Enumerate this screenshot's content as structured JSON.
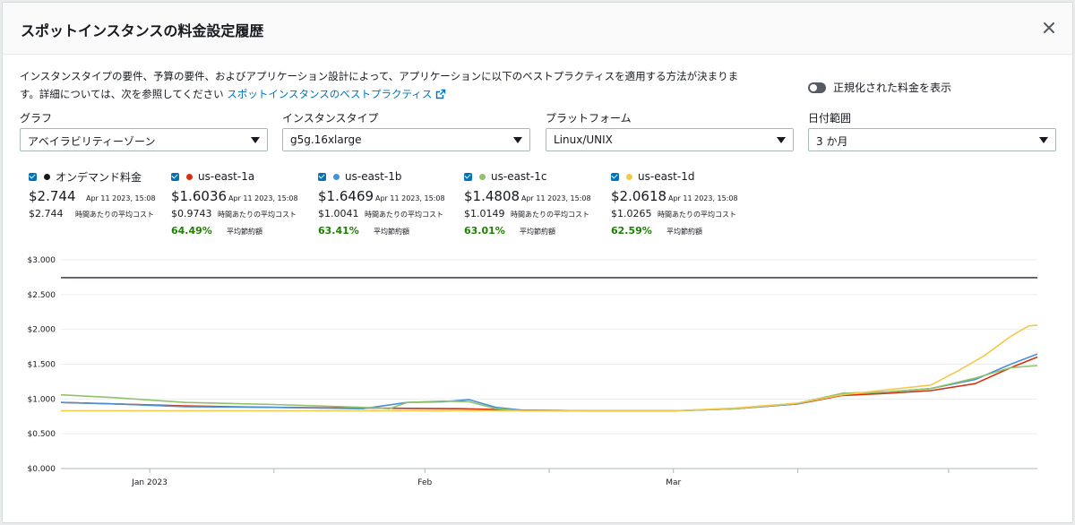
{
  "modal": {
    "title": "スポットインスタンスの料金設定履歴",
    "close_icon": "close-icon"
  },
  "description": {
    "text": "インスタンスタイプの要件、予算の要件、およびアプリケーション設計によって、アプリケーションに以下のベストプラクティスを適用する方法が決まります。詳細については、次を参照してください",
    "link_label": "スポットインスタンスのベストプラクティス",
    "link_icon": "external-link-icon"
  },
  "toggle": {
    "label": "正規化された料金を表示",
    "on": false
  },
  "filters": [
    {
      "label": "グラフ",
      "value": "アベイラビリティーゾーン"
    },
    {
      "label": "インスタンスタイプ",
      "value": "g5g.16xlarge"
    },
    {
      "label": "プラットフォーム",
      "value": "Linux/UNIX"
    },
    {
      "label": "日付範囲",
      "value": "3 か月"
    }
  ],
  "legend": [
    {
      "name": "オンデマンド料金",
      "color": "#16191f",
      "price": "$2.744",
      "timestamp": "Apr 11 2023, 15:08",
      "avg": "$2.744",
      "avg_label": "時間あたりの平均コスト",
      "savings": "",
      "savings_label": ""
    },
    {
      "name": "us-east-1a",
      "color": "#d13212",
      "price": "$1.6036",
      "timestamp": "Apr 11 2023, 15:08",
      "avg": "$0.9743",
      "avg_label": "時間あたりの平均コスト",
      "savings": "64.49%",
      "savings_label": "平均節約額"
    },
    {
      "name": "us-east-1b",
      "color": "#4a90d9",
      "price": "$1.6469",
      "timestamp": "Apr 11 2023, 15:08",
      "avg": "$1.0041",
      "avg_label": "時間あたりの平均コスト",
      "savings": "63.41%",
      "savings_label": "平均節約額"
    },
    {
      "name": "us-east-1c",
      "color": "#8fc26a",
      "price": "$1.4808",
      "timestamp": "Apr 11 2023, 15:08",
      "avg": "$1.0149",
      "avg_label": "時間あたりの平均コスト",
      "savings": "63.01%",
      "savings_label": "平均節約額"
    },
    {
      "name": "us-east-1d",
      "color": "#f2c94c",
      "price": "$2.0618",
      "timestamp": "Apr 11 2023, 15:08",
      "avg": "$1.0265",
      "avg_label": "時間あたりの平均コスト",
      "savings": "62.59%",
      "savings_label": "平均節約額"
    }
  ],
  "chart_data": {
    "type": "line",
    "ylim": [
      0,
      3
    ],
    "yticks": [
      "$3.000",
      "$2.500",
      "$2.000",
      "$1.500",
      "$1.000",
      "$0.500",
      "$0.000"
    ],
    "xticks": [
      "Jan 2023",
      "Feb",
      "Mar"
    ],
    "grid": true,
    "xlim": [
      "2022-12-22",
      "2023-04-11"
    ],
    "series": [
      {
        "name": "オンデマンド料金",
        "color": "#414750",
        "x": [
          "2022-12-22",
          "2023-04-11"
        ],
        "y": [
          2.744,
          2.744
        ]
      },
      {
        "name": "us-east-1a",
        "color": "#d13212",
        "x": [
          "2022-12-22",
          "2022-12-28",
          "2023-01-05",
          "2023-01-15",
          "2023-01-25",
          "2023-02-05",
          "2023-02-12",
          "2023-02-20",
          "2023-03-01",
          "2023-03-08",
          "2023-03-15",
          "2023-03-20",
          "2023-03-25",
          "2023-03-30",
          "2023-04-04",
          "2023-04-08",
          "2023-04-11"
        ],
        "y": [
          0.95,
          0.93,
          0.9,
          0.88,
          0.87,
          0.86,
          0.84,
          0.83,
          0.83,
          0.86,
          0.93,
          1.05,
          1.08,
          1.12,
          1.22,
          1.45,
          1.6036
        ]
      },
      {
        "name": "us-east-1b",
        "color": "#4a90d9",
        "x": [
          "2022-12-22",
          "2022-12-28",
          "2023-01-05",
          "2023-01-15",
          "2023-01-25",
          "2023-01-30",
          "2023-02-03",
          "2023-02-06",
          "2023-02-09",
          "2023-02-12",
          "2023-02-20",
          "2023-03-01",
          "2023-03-08",
          "2023-03-15",
          "2023-03-20",
          "2023-03-25",
          "2023-03-30",
          "2023-04-04",
          "2023-04-08",
          "2023-04-11"
        ],
        "y": [
          0.95,
          0.93,
          0.89,
          0.88,
          0.86,
          0.95,
          0.96,
          0.99,
          0.88,
          0.84,
          0.83,
          0.83,
          0.86,
          0.93,
          1.08,
          1.1,
          1.15,
          1.28,
          1.5,
          1.6469
        ]
      },
      {
        "name": "us-east-1c",
        "color": "#8fc26a",
        "x": [
          "2022-12-22",
          "2022-12-28",
          "2023-01-05",
          "2023-01-15",
          "2023-01-25",
          "2023-01-28",
          "2023-01-30",
          "2023-02-03",
          "2023-02-06",
          "2023-02-09",
          "2023-02-12",
          "2023-02-20",
          "2023-03-01",
          "2023-03-08",
          "2023-03-15",
          "2023-03-20",
          "2023-03-25",
          "2023-03-30",
          "2023-04-04",
          "2023-04-08",
          "2023-04-11"
        ],
        "y": [
          1.06,
          1.02,
          0.95,
          0.92,
          0.88,
          0.86,
          0.95,
          0.97,
          0.96,
          0.86,
          0.83,
          0.83,
          0.83,
          0.86,
          0.94,
          1.08,
          1.1,
          1.15,
          1.3,
          1.45,
          1.4808
        ]
      },
      {
        "name": "us-east-1d",
        "color": "#f2c94c",
        "x": [
          "2022-12-22",
          "2023-01-15",
          "2023-02-12",
          "2023-02-20",
          "2023-03-01",
          "2023-03-08",
          "2023-03-15",
          "2023-03-20",
          "2023-03-25",
          "2023-03-30",
          "2023-04-02",
          "2023-04-05",
          "2023-04-08",
          "2023-04-10",
          "2023-04-11"
        ],
        "y": [
          0.83,
          0.83,
          0.83,
          0.83,
          0.83,
          0.87,
          0.94,
          1.06,
          1.13,
          1.2,
          1.4,
          1.62,
          1.9,
          2.05,
          2.0618
        ]
      }
    ]
  }
}
